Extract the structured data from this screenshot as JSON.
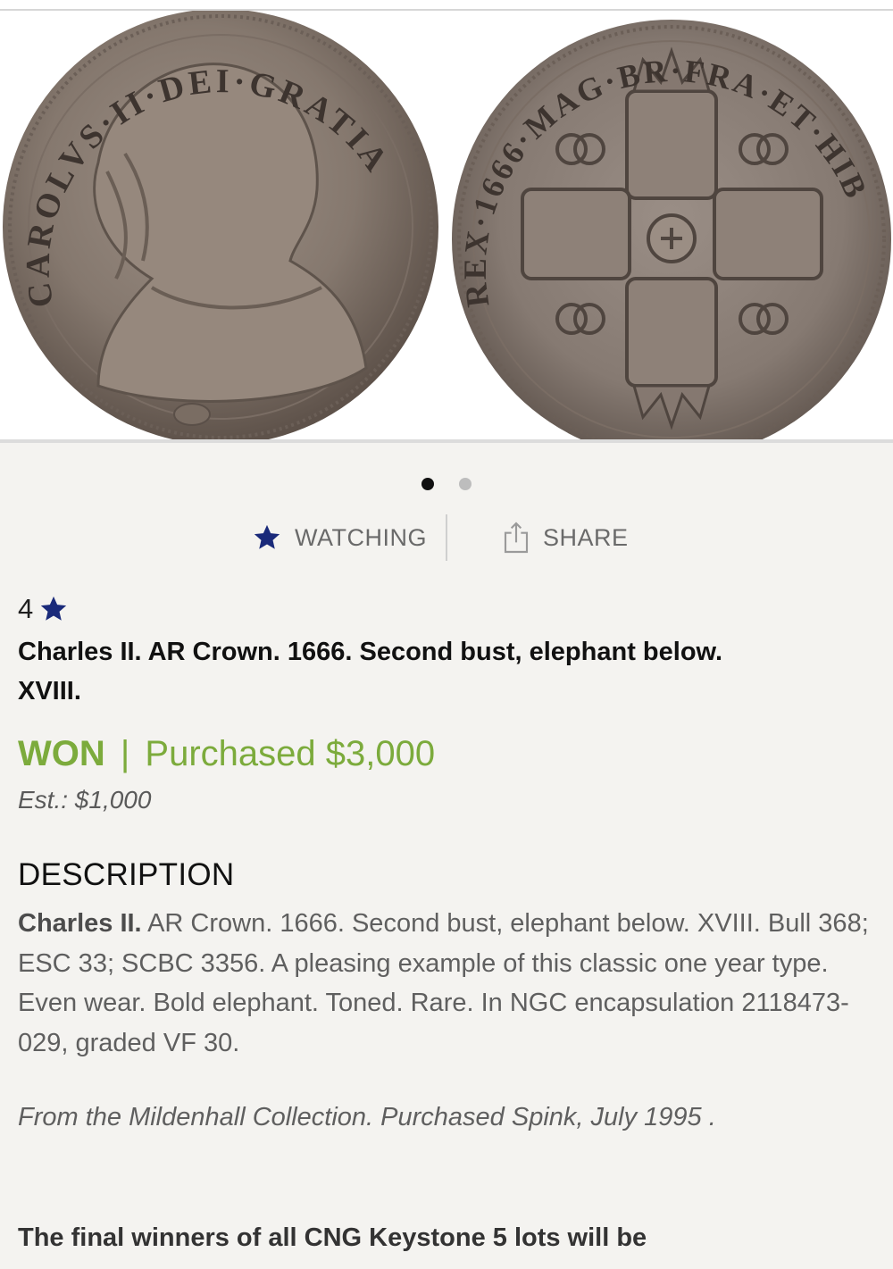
{
  "gallery": {
    "obverse_legend": "CAROLVS·II·DEI·GRATIA",
    "reverse_legend": "REX·1666·MAG·BR·FRA·ET·HIB",
    "slide_count": 2,
    "active_slide": 1
  },
  "actions": {
    "watch_label": "WATCHING",
    "share_label": "SHARE"
  },
  "lot": {
    "number": "4",
    "title": "Charles II. AR Crown. 1666. Second bust, elephant below. XVIII.",
    "status_won": "WON",
    "status_sep": "|",
    "status_purchased": "Purchased $3,000",
    "estimate": "Est.: $1,000"
  },
  "description": {
    "heading": "DESCRIPTION",
    "lead": "Charles II.",
    "body": " AR Crown. 1666. Second bust, elephant below. XVIII. Bull 368; ESC 33; SCBC 3356. A pleasing example of this classic one year type. Even wear. Bold elephant. Toned. Rare. In NGC encapsulation 2118473-029, graded VF 30.",
    "provenance": "From the Mildenhall Collection. Purchased Spink, July 1995 .",
    "final_note": "The final winners of all CNG Keystone 5 lots will be"
  },
  "colors": {
    "accent_green": "#7cab3c",
    "star_navy": "#1a2a7a"
  }
}
